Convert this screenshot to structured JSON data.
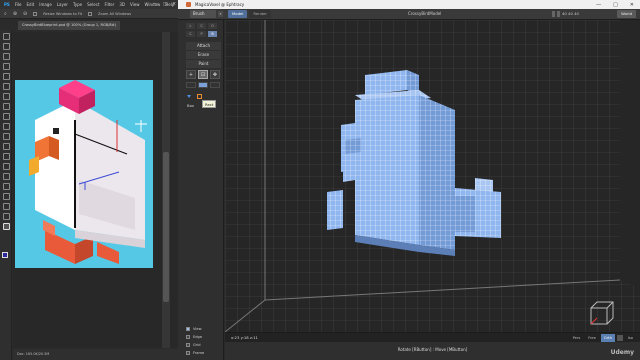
{
  "photoshop": {
    "menu": [
      "PS",
      "File",
      "Edit",
      "Image",
      "Layer",
      "Type",
      "Select",
      "Filter",
      "3D",
      "View",
      "Window",
      "Help"
    ],
    "window_controls": [
      "—",
      "□",
      "✕"
    ],
    "options": {
      "resize_windows": "Resize Windows to Fit",
      "zoom_all": "Zoom All Windows",
      "scrubby": "Scrubby Zoom",
      "percent": "100%",
      "fit_screen": "Fit Screen",
      "fill_screen": "Fill Screen"
    },
    "doc_tab": "CrossyBirdBlueprint.psd @ 100% (Group 1, RGB/8#)",
    "status": "Doc: 165.0K/20.5M"
  },
  "magicavoxel": {
    "title": "MagicaVoxel @ Ephtracy",
    "window_controls": [
      "—",
      "□",
      "✕"
    ],
    "brush_label": "Brush",
    "tabs": [
      "Model",
      "Render"
    ],
    "active_tab": "Model",
    "filename": "CrossyBirdModel",
    "dims": "40 40 40",
    "world_button": "World",
    "num_row1": [
      "L",
      "C",
      "O"
    ],
    "num_row2": [
      "C",
      "P",
      "B"
    ],
    "modes": [
      "Attach",
      "Erase",
      "Paint"
    ],
    "tools": [
      "+",
      "⊡",
      "✥"
    ],
    "box_label": "Box",
    "tooltip": "Rect",
    "bottom_items": [
      "View",
      "Edge",
      "Grid",
      "Frame"
    ],
    "coords": "x:23  y:18  z:11",
    "viewport_modes": [
      "Pers",
      "Free",
      "Orth",
      "Iso"
    ],
    "active_viewport_mode": "Orth",
    "hint": "Rotate [RButton] : Move [MButton]",
    "watermark": "Udemy"
  }
}
